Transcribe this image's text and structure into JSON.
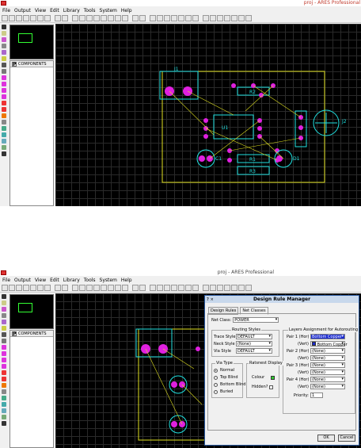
{
  "window": {
    "title": "proj - ARES Professional",
    "menu": [
      "File",
      "Output",
      "View",
      "Edit",
      "Library",
      "Tools",
      "System",
      "Help"
    ]
  },
  "sidebar": {
    "components_label": "COMPONENTS",
    "p_button": "P"
  },
  "pcb_labels": [
    "J1",
    "R2",
    "U1",
    "C1",
    "R1",
    "R3",
    "D1",
    "J2"
  ],
  "dialog": {
    "title": "Design Rule Manager",
    "tabs": [
      "Design Rules",
      "Net Classes"
    ],
    "net_class_label": "Net Class:",
    "net_class_value": "POWER",
    "routing_styles_title": "Routing Styles",
    "trace_style_label": "Trace Style",
    "trace_style_value": "DEFAULT",
    "neck_style_label": "Neck Style",
    "neck_style_value": "(None)",
    "via_style_label": "Via Style",
    "via_style_value": "DEFAULT",
    "layers_title": "Layers Assignment for Autorouting",
    "pairs": [
      {
        "label": "Pair 1 (Hor)",
        "value": "Bottom Copper",
        "highlight": true
      },
      {
        "label": "(Vert)",
        "value": "Bottom Copper",
        "highlight": false
      },
      {
        "label": "Pair 2 (Hor)",
        "value": "(None)",
        "highlight": false
      },
      {
        "label": "(Vert)",
        "value": "(None)",
        "highlight": false
      },
      {
        "label": "Pair 3 (Hor)",
        "value": "(None)",
        "highlight": false
      },
      {
        "label": "(Vert)",
        "value": "(None)",
        "highlight": false
      },
      {
        "label": "Pair 4 (Hor)",
        "value": "(None)",
        "highlight": false
      },
      {
        "label": "(Vert)",
        "value": "(None)",
        "highlight": false
      }
    ],
    "priority_label": "Priority:",
    "priority_value": "1",
    "via_type_title": "Via Type",
    "via_types": [
      "Normal",
      "Top Blind",
      "Bottom Blind",
      "Buried"
    ],
    "ratsnest_title": "Ratsnest Display",
    "colour_label": "Colour",
    "hidden_label": "Hidden?",
    "ok_label": "OK",
    "cancel_label": "Cancel"
  },
  "colors": {
    "pad": "#e020e0",
    "outline": "#e0e020",
    "silk": "#20e0e0",
    "ratsnest": "#ffff00",
    "selection_blue": "#1a2ad0"
  }
}
